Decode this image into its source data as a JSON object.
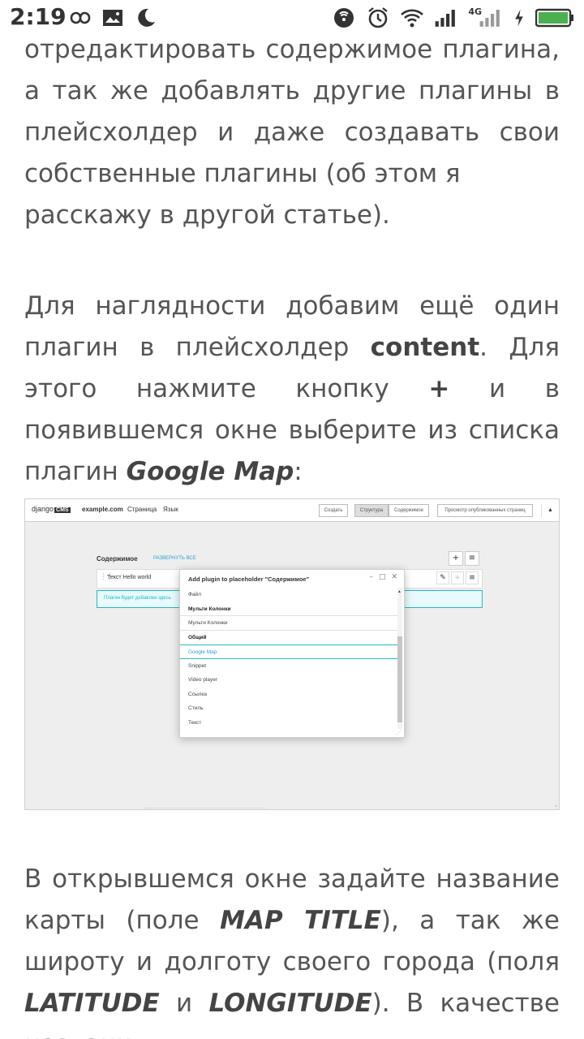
{
  "status_bar": {
    "time": "2:19",
    "network": "4G",
    "left_icons": [
      "infinity-icon",
      "image-icon",
      "moon-icon"
    ],
    "right_icons": [
      "nfc-icon",
      "alarm-icon",
      "wifi-icon",
      "signal-icon",
      "signal-4g-icon",
      "charging-icon",
      "battery-icon"
    ],
    "battery_color": "#4caf50"
  },
  "article": {
    "p1": "отредактировать содержимое плагина, а так же добавлять другие плагины в плейсхолдер и даже создавать свои собственные плагины (об этом я",
    "p1_last": "расскажу в другой статье).",
    "p2_a": "Для наглядности добавим ещё один плагин в плейсхолдер",
    "p2_b": "content",
    "p2_c": ". Для этого нажмите кнопку",
    "p2_d": "+",
    "p2_e": "и в появившемся окне выберите из списка плагин",
    "p2_f": "Google Map",
    "p2_g": ":",
    "p3_a": "В открывшемся окне задайте название карты (поле",
    "p3_b": "MAP TITLE",
    "p3_c": "), а так же широту и долготу своего города (поля",
    "p3_d": "LATITUDE",
    "p3_e": "и",
    "p3_f": "LONGITUDE",
    "p3_g": "). В качестве названия у"
  },
  "screenshot": {
    "toolbar": {
      "logo_text": "django",
      "logo_box": "CMS",
      "site": "example.com",
      "page_menu": "Страница",
      "lang_menu": "Язык",
      "create": "Создать",
      "structure": "Структура",
      "content": "Содержимое",
      "preview": "Просмотр опубликованных страниц",
      "caret": "▲"
    },
    "placeholder_title": "Содержимое",
    "expand_all": "РАЗВЕРНУТЬ ВСЕ",
    "plugin_label": "Текст Hello world",
    "drop_hint": "Плагин будет добавлен здесь",
    "modal": {
      "title": "Add plugin to placeholder \"Содержимое\"",
      "items": [
        {
          "label": "Файл",
          "kind": "item"
        },
        {
          "label": "Мульти Колонки",
          "kind": "group"
        },
        {
          "label": "Мульти Колонки",
          "kind": "item"
        },
        {
          "label": "Общий",
          "kind": "group"
        },
        {
          "label": "Google Map",
          "kind": "selected"
        },
        {
          "label": "Snippet",
          "kind": "item"
        },
        {
          "label": "Video player",
          "kind": "item"
        },
        {
          "label": "Ссылка",
          "kind": "item"
        },
        {
          "label": "Стиль",
          "kind": "item"
        },
        {
          "label": "Текст",
          "kind": "item"
        }
      ]
    }
  }
}
